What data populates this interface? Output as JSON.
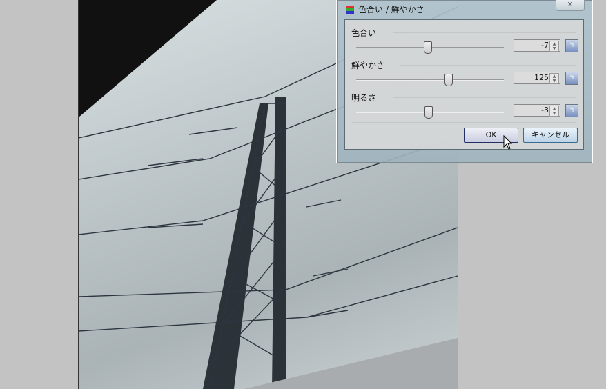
{
  "dialog": {
    "title": "色合い / 鮮やかさ",
    "close_label": "✕",
    "sliders": [
      {
        "label": "色合い",
        "value": "-7",
        "fraction": 0.48
      },
      {
        "label": "鮮やかさ",
        "value": "125",
        "fraction": 0.62
      },
      {
        "label": "明るさ",
        "value": "-3",
        "fraction": 0.485
      }
    ],
    "ok_label": "OK",
    "cancel_label": "キャンセル"
  },
  "icons": {
    "reset": "reset-icon",
    "spin": "spin-icon"
  }
}
